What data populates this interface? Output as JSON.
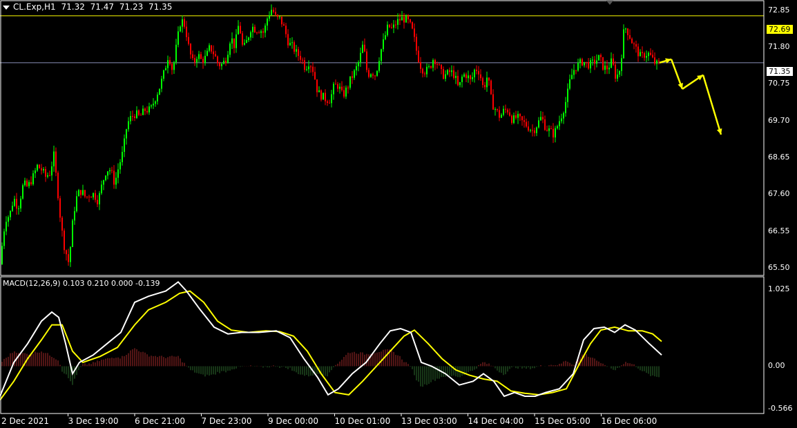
{
  "header": {
    "symbol": "CL.Exp,H1",
    "open": "71.32",
    "high": "71.47",
    "low": "71.23",
    "close": "71.35"
  },
  "macd_header": {
    "label": "MACD(12,26,9)",
    "v1": "0.103",
    "v2": "0.210",
    "v3": "0.000",
    "v4": "-0.139"
  },
  "price_axis": [
    "72.85",
    "71.80",
    "70.75",
    "69.70",
    "68.65",
    "67.60",
    "66.55",
    "65.50"
  ],
  "macd_axis": [
    "1.025",
    "0.00",
    "-0.566"
  ],
  "price_tags": {
    "resistance": "72.69",
    "current": "71.35"
  },
  "time_axis": [
    "2 Dec 2021",
    "3 Dec 19:00",
    "6 Dec 21:00",
    "7 Dec 23:00",
    "9 Dec 00:00",
    "10 Dec 01:00",
    "13 Dec 03:00",
    "14 Dec 04:00",
    "15 Dec 05:00",
    "16 Dec 06:00"
  ],
  "colors": {
    "bull": "#00ff00",
    "bear": "#ff0000",
    "resistance_line": "#ffff00",
    "current_line": "#8a8fb8",
    "signal": "#ffff00",
    "macd_line": "#ffffff",
    "hist_pos": "#a52a2a",
    "hist_neg": "#2e6b2e",
    "arrow": "#ffff00",
    "grid": "#ffffff"
  },
  "chart_data": {
    "type": "candlestick",
    "symbol": "CL.Exp",
    "timeframe": "H1",
    "price_range": [
      65.3,
      73.1
    ],
    "key_levels": [
      72.69,
      71.35
    ],
    "price_path": [
      [
        0,
        65.6
      ],
      [
        4,
        66.3
      ],
      [
        8,
        66.9
      ],
      [
        14,
        67.0
      ],
      [
        20,
        67.5
      ],
      [
        26,
        67.2
      ],
      [
        34,
        67.9
      ],
      [
        40,
        67.8
      ],
      [
        48,
        68.1
      ],
      [
        54,
        68.4
      ],
      [
        60,
        68.3
      ],
      [
        66,
        68.1
      ],
      [
        72,
        68.2
      ],
      [
        78,
        68.7
      ],
      [
        84,
        67.6
      ],
      [
        88,
        66.8
      ],
      [
        92,
        66.2
      ],
      [
        96,
        65.9
      ],
      [
        100,
        65.6
      ],
      [
        104,
        66.6
      ],
      [
        108,
        67.2
      ],
      [
        112,
        67.6
      ],
      [
        118,
        67.7
      ],
      [
        124,
        67.5
      ],
      [
        130,
        67.6
      ],
      [
        136,
        67.6
      ],
      [
        142,
        67.4
      ],
      [
        148,
        67.9
      ],
      [
        154,
        68.3
      ],
      [
        160,
        68.3
      ],
      [
        166,
        67.9
      ],
      [
        172,
        68.4
      ],
      [
        178,
        68.8
      ],
      [
        184,
        69.6
      ],
      [
        190,
        69.8
      ],
      [
        196,
        69.9
      ],
      [
        202,
        69.8
      ],
      [
        210,
        70.0
      ],
      [
        218,
        70.0
      ],
      [
        226,
        70.4
      ],
      [
        232,
        70.7
      ],
      [
        238,
        71.1
      ],
      [
        244,
        71.6
      ],
      [
        250,
        71.1
      ],
      [
        256,
        71.9
      ],
      [
        262,
        72.6
      ],
      [
        268,
        72.4
      ],
      [
        274,
        71.7
      ],
      [
        280,
        71.3
      ],
      [
        286,
        71.6
      ],
      [
        292,
        71.4
      ],
      [
        298,
        71.5
      ],
      [
        304,
        71.8
      ],
      [
        310,
        71.6
      ],
      [
        316,
        71.3
      ],
      [
        322,
        71.3
      ],
      [
        328,
        71.5
      ],
      [
        334,
        72.1
      ],
      [
        340,
        71.8
      ],
      [
        346,
        72.5
      ],
      [
        352,
        71.7
      ],
      [
        358,
        72.0
      ],
      [
        364,
        72.4
      ],
      [
        370,
        72.3
      ],
      [
        376,
        72.3
      ],
      [
        382,
        72.2
      ],
      [
        388,
        72.7
      ],
      [
        394,
        72.9
      ],
      [
        400,
        72.6
      ],
      [
        406,
        72.6
      ],
      [
        412,
        72.3
      ],
      [
        418,
        71.9
      ],
      [
        424,
        71.8
      ],
      [
        430,
        71.6
      ],
      [
        436,
        71.5
      ],
      [
        442,
        71.2
      ],
      [
        448,
        71.4
      ],
      [
        454,
        71.1
      ],
      [
        460,
        70.5
      ],
      [
        466,
        70.4
      ],
      [
        472,
        70.3
      ],
      [
        478,
        70.3
      ],
      [
        484,
        70.7
      ],
      [
        490,
        70.7
      ],
      [
        496,
        70.4
      ],
      [
        502,
        70.6
      ],
      [
        508,
        70.9
      ],
      [
        514,
        71.1
      ],
      [
        520,
        71.4
      ],
      [
        526,
        71.9
      ],
      [
        532,
        71.0
      ],
      [
        538,
        71.1
      ],
      [
        544,
        71.0
      ],
      [
        550,
        71.6
      ],
      [
        556,
        72.0
      ],
      [
        562,
        72.4
      ],
      [
        568,
        72.3
      ],
      [
        574,
        72.5
      ],
      [
        580,
        72.6
      ],
      [
        586,
        72.6
      ],
      [
        592,
        72.5
      ],
      [
        598,
        72.2
      ],
      [
        604,
        71.6
      ],
      [
        610,
        71.2
      ],
      [
        616,
        71.1
      ],
      [
        622,
        71.2
      ],
      [
        628,
        71.5
      ],
      [
        634,
        71.3
      ],
      [
        640,
        71.0
      ],
      [
        646,
        71.0
      ],
      [
        652,
        71.1
      ],
      [
        658,
        71.0
      ],
      [
        664,
        70.6
      ],
      [
        670,
        71.0
      ],
      [
        676,
        71.0
      ],
      [
        682,
        70.8
      ],
      [
        688,
        71.2
      ],
      [
        694,
        71.1
      ],
      [
        700,
        70.6
      ],
      [
        706,
        71.0
      ],
      [
        712,
        70.2
      ],
      [
        718,
        70.0
      ],
      [
        724,
        69.8
      ],
      [
        730,
        70.0
      ],
      [
        736,
        70.0
      ],
      [
        742,
        69.7
      ],
      [
        748,
        69.8
      ],
      [
        754,
        69.7
      ],
      [
        760,
        69.6
      ],
      [
        766,
        69.5
      ],
      [
        772,
        69.4
      ],
      [
        778,
        69.6
      ],
      [
        784,
        69.8
      ],
      [
        790,
        69.5
      ],
      [
        796,
        69.4
      ],
      [
        802,
        69.3
      ],
      [
        808,
        69.6
      ],
      [
        814,
        69.9
      ],
      [
        820,
        70.3
      ],
      [
        826,
        70.9
      ],
      [
        832,
        71.2
      ],
      [
        838,
        71.3
      ],
      [
        844,
        71.4
      ],
      [
        850,
        71.3
      ],
      [
        856,
        71.3
      ],
      [
        862,
        71.4
      ],
      [
        868,
        71.5
      ],
      [
        874,
        71.2
      ],
      [
        880,
        71.2
      ],
      [
        886,
        71.4
      ],
      [
        892,
        70.9
      ],
      [
        898,
        71.2
      ],
      [
        904,
        72.4
      ],
      [
        910,
        72.2
      ],
      [
        916,
        71.9
      ],
      [
        922,
        71.7
      ],
      [
        928,
        71.5
      ],
      [
        934,
        71.6
      ],
      [
        940,
        71.6
      ],
      [
        946,
        71.4
      ],
      [
        950,
        71.3
      ],
      [
        956,
        71.35
      ]
    ],
    "macd": {
      "label": "MACD(12,26,9)",
      "range": [
        -0.566,
        1.025
      ],
      "main_path": [
        [
          0,
          -0.4
        ],
        [
          20,
          0.05
        ],
        [
          40,
          0.3
        ],
        [
          60,
          0.6
        ],
        [
          75,
          0.72
        ],
        [
          85,
          0.65
        ],
        [
          95,
          0.3
        ],
        [
          105,
          -0.1
        ],
        [
          115,
          0.05
        ],
        [
          135,
          0.15
        ],
        [
          155,
          0.3
        ],
        [
          175,
          0.45
        ],
        [
          195,
          0.85
        ],
        [
          215,
          0.93
        ],
        [
          240,
          1.0
        ],
        [
          258,
          1.12
        ],
        [
          270,
          1.0
        ],
        [
          290,
          0.75
        ],
        [
          310,
          0.52
        ],
        [
          330,
          0.43
        ],
        [
          350,
          0.45
        ],
        [
          375,
          0.45
        ],
        [
          400,
          0.47
        ],
        [
          420,
          0.38
        ],
        [
          440,
          0.1
        ],
        [
          460,
          -0.15
        ],
        [
          475,
          -0.38
        ],
        [
          490,
          -0.3
        ],
        [
          510,
          -0.1
        ],
        [
          530,
          0.05
        ],
        [
          550,
          0.3
        ],
        [
          565,
          0.47
        ],
        [
          580,
          0.5
        ],
        [
          595,
          0.45
        ],
        [
          610,
          0.05
        ],
        [
          625,
          0.0
        ],
        [
          645,
          -0.1
        ],
        [
          665,
          -0.25
        ],
        [
          685,
          -0.2
        ],
        [
          700,
          -0.1
        ],
        [
          715,
          -0.2
        ],
        [
          730,
          -0.4
        ],
        [
          745,
          -0.35
        ],
        [
          760,
          -0.4
        ],
        [
          775,
          -0.4
        ],
        [
          790,
          -0.35
        ],
        [
          810,
          -0.3
        ],
        [
          830,
          -0.1
        ],
        [
          845,
          0.35
        ],
        [
          860,
          0.5
        ],
        [
          875,
          0.52
        ],
        [
          890,
          0.45
        ],
        [
          905,
          0.55
        ],
        [
          920,
          0.48
        ],
        [
          940,
          0.3
        ],
        [
          958,
          0.15
        ]
      ],
      "signal_path": [
        [
          0,
          -0.45
        ],
        [
          20,
          -0.2
        ],
        [
          40,
          0.1
        ],
        [
          60,
          0.35
        ],
        [
          75,
          0.55
        ],
        [
          90,
          0.55
        ],
        [
          105,
          0.2
        ],
        [
          120,
          0.05
        ],
        [
          145,
          0.13
        ],
        [
          170,
          0.25
        ],
        [
          195,
          0.55
        ],
        [
          215,
          0.75
        ],
        [
          240,
          0.85
        ],
        [
          260,
          0.97
        ],
        [
          275,
          1.0
        ],
        [
          295,
          0.85
        ],
        [
          315,
          0.6
        ],
        [
          335,
          0.48
        ],
        [
          360,
          0.45
        ],
        [
          385,
          0.47
        ],
        [
          405,
          0.46
        ],
        [
          425,
          0.4
        ],
        [
          445,
          0.2
        ],
        [
          465,
          -0.1
        ],
        [
          485,
          -0.35
        ],
        [
          505,
          -0.38
        ],
        [
          525,
          -0.2
        ],
        [
          545,
          0.0
        ],
        [
          565,
          0.2
        ],
        [
          585,
          0.4
        ],
        [
          600,
          0.48
        ],
        [
          620,
          0.3
        ],
        [
          640,
          0.1
        ],
        [
          660,
          -0.05
        ],
        [
          680,
          -0.12
        ],
        [
          700,
          -0.17
        ],
        [
          720,
          -0.2
        ],
        [
          740,
          -0.33
        ],
        [
          760,
          -0.36
        ],
        [
          780,
          -0.38
        ],
        [
          800,
          -0.35
        ],
        [
          820,
          -0.3
        ],
        [
          840,
          0.05
        ],
        [
          855,
          0.3
        ],
        [
          870,
          0.48
        ],
        [
          890,
          0.52
        ],
        [
          910,
          0.47
        ],
        [
          930,
          0.47
        ],
        [
          945,
          0.43
        ],
        [
          958,
          0.33
        ]
      ]
    },
    "forecast_arrows": [
      {
        "from": [
          955,
          71.35
        ],
        "to": [
          972,
          71.45
        ]
      },
      {
        "from": [
          972,
          71.45
        ],
        "to": [
          988,
          70.6
        ]
      },
      {
        "from": [
          988,
          70.6
        ],
        "to": [
          1018,
          71.0
        ]
      },
      {
        "from": [
          1018,
          71.0
        ],
        "to": [
          1044,
          69.3
        ]
      }
    ]
  }
}
